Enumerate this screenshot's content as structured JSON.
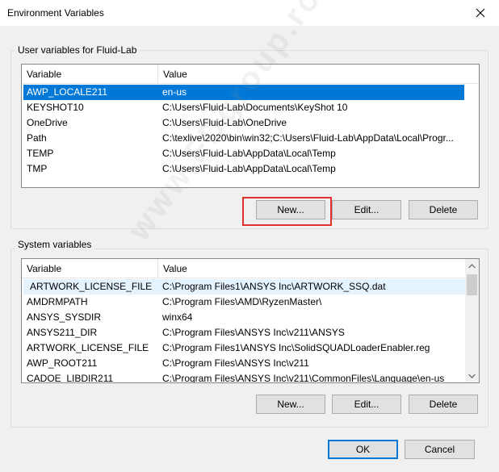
{
  "window": {
    "title": "Environment Variables"
  },
  "user_vars": {
    "label": "User variables for Fluid-Lab",
    "columns": [
      "Variable",
      "Value"
    ],
    "rows": [
      {
        "name": "AWP_LOCALE211",
        "value": "en-us"
      },
      {
        "name": "KEYSHOT10",
        "value": "C:\\Users\\Fluid-Lab\\Documents\\KeyShot 10"
      },
      {
        "name": "OneDrive",
        "value": "C:\\Users\\Fluid-Lab\\OneDrive"
      },
      {
        "name": "Path",
        "value": "C:\\texlive\\2020\\bin\\win32;C:\\Users\\Fluid-Lab\\AppData\\Local\\Progr..."
      },
      {
        "name": "TEMP",
        "value": "C:\\Users\\Fluid-Lab\\AppData\\Local\\Temp"
      },
      {
        "name": "TMP",
        "value": "C:\\Users\\Fluid-Lab\\AppData\\Local\\Temp"
      }
    ],
    "buttons": {
      "new": "New...",
      "edit": "Edit...",
      "delete": "Delete"
    }
  },
  "system_vars": {
    "label": "System variables",
    "columns": [
      "Variable",
      "Value"
    ],
    "rows": [
      {
        "name": "ARTWORK_LICENSE_FILE",
        "value": "C:\\Program Files1\\ANSYS Inc\\ARTWORK_SSQ.dat"
      },
      {
        "name": "AMDRMPATH",
        "value": "C:\\Program Files\\AMD\\RyzenMaster\\"
      },
      {
        "name": "ANSYS_SYSDIR",
        "value": "winx64"
      },
      {
        "name": "ANSYS211_DIR",
        "value": "C:\\Program Files\\ANSYS Inc\\v211\\ANSYS"
      },
      {
        "name": "ARTWORK_LICENSE_FILE",
        "value": "C:\\Program Files1\\ANSYS Inc\\SolidSQUADLoaderEnabler.reg"
      },
      {
        "name": "AWP_ROOT211",
        "value": "C:\\Program Files\\ANSYS Inc\\v211"
      },
      {
        "name": "CADOE_LIBDIR211",
        "value": "C:\\Program Files\\ANSYS Inc\\v211\\CommonFiles\\Language\\en-us"
      }
    ],
    "buttons": {
      "new": "New...",
      "edit": "Edit...",
      "delete": "Delete"
    }
  },
  "footer": {
    "ok": "OK",
    "cancel": "Cancel"
  },
  "watermark": "www.FDgroup.ro",
  "colors": {
    "selection": "#0078d7",
    "highlight_box": "#e0312f",
    "hover_row": "#e5f3ff"
  },
  "icons": {
    "close": "close-icon",
    "scroll_up": "chevron-up-icon",
    "scroll_down": "chevron-down-icon"
  }
}
